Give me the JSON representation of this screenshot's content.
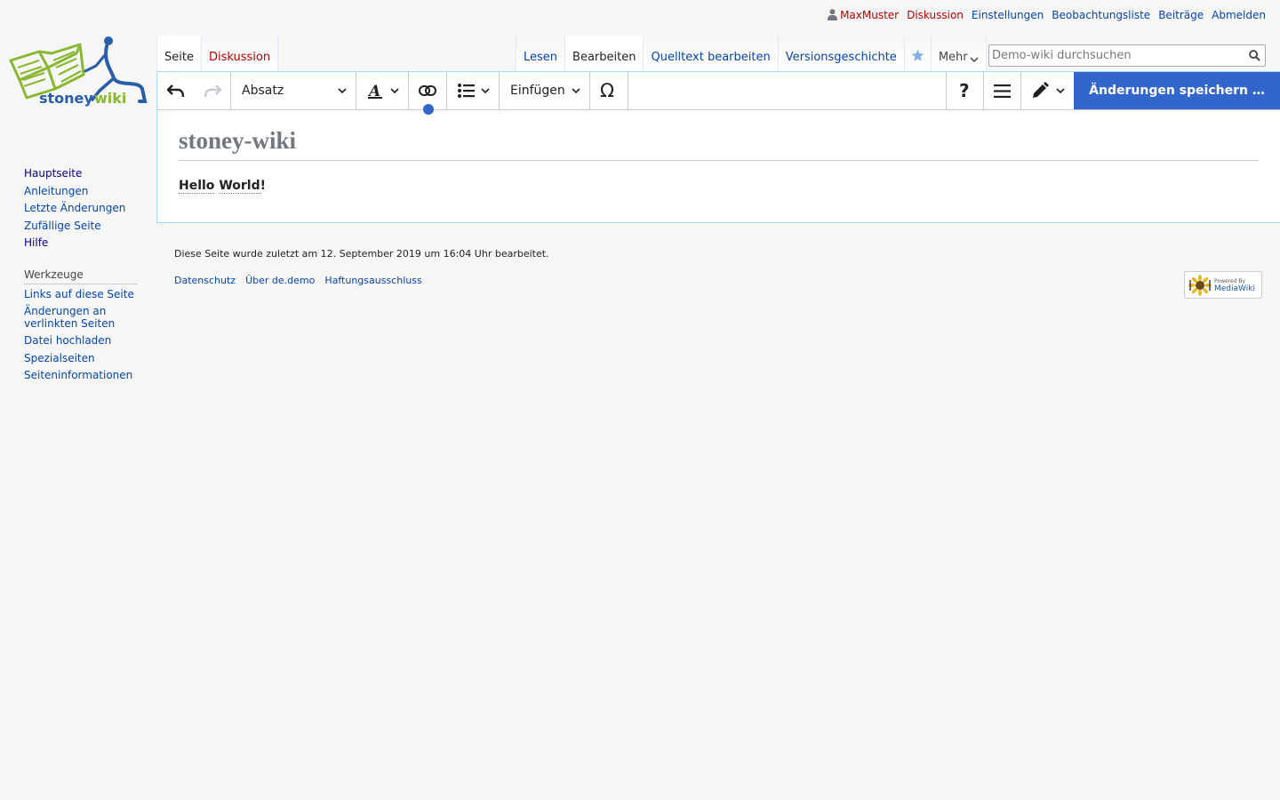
{
  "personal": {
    "username": "MaxMuster",
    "talk": "Diskussion",
    "preferences": "Einstellungen",
    "watchlist": "Beobachtungsliste",
    "contributions": "Beiträge",
    "logout": "Abmelden"
  },
  "logo": {
    "text_a": "stoney",
    "text_b": "wiki",
    "colors": {
      "green": "#8ab832",
      "blue": "#2a5da8"
    }
  },
  "tabs": {
    "page": "Seite",
    "talk": "Diskussion",
    "read": "Lesen",
    "edit": "Bearbeiten",
    "edit_source": "Quelltext bearbeiten",
    "history": "Versionsgeschichte",
    "more": "Mehr"
  },
  "search": {
    "placeholder": "Demo-wiki durchsuchen"
  },
  "sidebar": {
    "nav": [
      "Hauptseite",
      "Anleitungen",
      "Letzte Änderungen",
      "Zufällige Seite",
      "Hilfe"
    ],
    "tools_heading": "Werkzeuge",
    "tools": [
      "Links auf diese Seite",
      "Änderungen an verlinkten Seiten",
      "Datei hochladen",
      "Spezialseiten",
      "Seiteninformationen"
    ]
  },
  "toolbar": {
    "paragraph": "Absatz",
    "insert": "Einfügen",
    "save": "Änderungen speichern …"
  },
  "page": {
    "title": "stoney-wiki",
    "body_word1": "Hello",
    "body_word2": "World",
    "body_punct": "!"
  },
  "footer": {
    "last_modified": "Diese Seite wurde zuletzt am 12. September 2019 um 16:04 Uhr bearbeitet.",
    "links": [
      "Datenschutz",
      "Über de.demo",
      "Haftungsausschluss"
    ],
    "powered_small": "Powered By",
    "powered_name": "MediaWiki"
  },
  "colors": {
    "accent": "#3366cc",
    "link": "#0645ad",
    "redlink": "#ba0000"
  }
}
